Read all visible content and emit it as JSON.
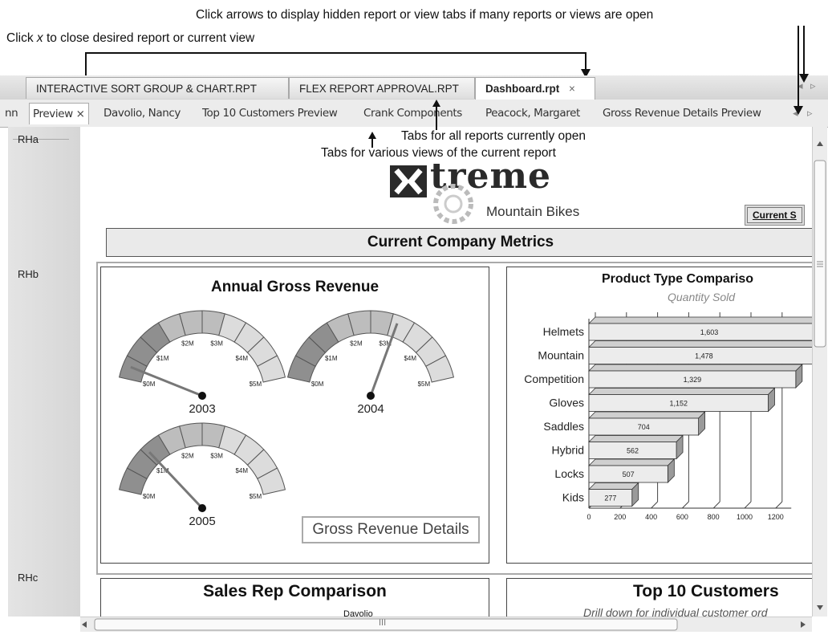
{
  "callouts": {
    "top": "Click arrows to display hidden report or view tabs if many reports or views are open",
    "close_prefix": "Click ",
    "close_x": "x",
    "close_suffix": " to close desired report or current view",
    "reports": "Tabs for all reports currently open",
    "views": "Tabs for various views of the current report"
  },
  "report_tabs": [
    {
      "label": "INTERACTIVE SORT GROUP & CHART.RPT"
    },
    {
      "label": "FLEX REPORT APPROVAL.RPT"
    },
    {
      "label": "Dashboard.rpt"
    }
  ],
  "close_glyph": "×",
  "view_tabs": [
    {
      "label": "ոn"
    },
    {
      "label": "Preview"
    },
    {
      "label": "Davolio, Nancy"
    },
    {
      "label": "Top 10 Customers Preview"
    },
    {
      "label": "Crank Components"
    },
    {
      "label": "Peacock, Margaret"
    },
    {
      "label": "Gross Revenue Details Preview"
    }
  ],
  "scroll_arrows": {
    "left": "◂",
    "right": "▹"
  },
  "sections": [
    "RHa",
    "RHb",
    "RHc"
  ],
  "logo": {
    "word": "treme",
    "tagline": "Mountain Bikes"
  },
  "current_button": "Current S",
  "metrics_title": "Current Company Metrics",
  "revenue_panel": {
    "title": "Annual Gross Revenue",
    "tick_labels": [
      "$0M",
      "$1M",
      "$2M",
      "$3M",
      "$4M",
      "$5M"
    ],
    "gauges": [
      {
        "year": "2003",
        "value_m": 0.3
      },
      {
        "year": "2004",
        "value_m": 3.15
      },
      {
        "year": "2005",
        "value_m": 1.1
      }
    ],
    "details_link": "Gross Revenue Details"
  },
  "chart_data": {
    "type": "bar",
    "orientation": "horizontal",
    "title": "Product Type Compariso",
    "subtitle": "Quantity Sold",
    "categories": [
      "Helmets",
      "Mountain",
      "Competition",
      "Gloves",
      "Saddles",
      "Hybrid",
      "Locks",
      "Kids"
    ],
    "values": [
      1603,
      1478,
      1329,
      1152,
      704,
      562,
      507,
      277
    ],
    "value_labels": [
      "1,603",
      "1,478",
      "1,329",
      "1,152",
      "704",
      "562",
      "507",
      "277"
    ],
    "x_ticks": [
      "0",
      "200",
      "400",
      "600",
      "800",
      "1000",
      "1200"
    ],
    "xlim": [
      0,
      1300
    ],
    "grid": true
  },
  "sales_panel": {
    "title": "Sales Rep Comparison",
    "partial": "Davolio"
  },
  "customers_panel": {
    "title": "Top 10 Customers",
    "subtitle": "Drill down for individual customer ord"
  },
  "hscroll_grip": "III"
}
